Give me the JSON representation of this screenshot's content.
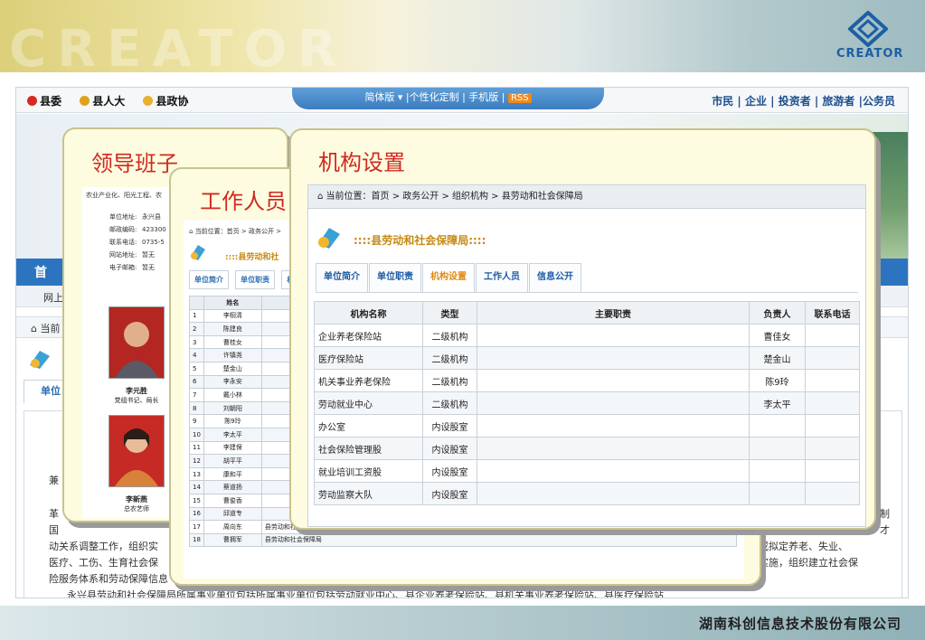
{
  "slide": {
    "watermark": "CREATOR",
    "logo_text": "CREATOR",
    "company": "湖南科创信息技术股份有限公司"
  },
  "bg_page": {
    "top_left_links": [
      "县委",
      "县人大",
      "县政协"
    ],
    "top_band": "简体版 ▾ |个性化定制 | 手机版 |",
    "rss": "RSS",
    "top_right_links": "市民 | 企业 | 投资者 | 旅游者 |公务员",
    "nav_home": "首",
    "subnav_text": "网上",
    "crumb_text": "当前",
    "unit_tab": "单位",
    "body_lines": [
      "兼",
      "革",
      "国",
      "动关系调整工作，组织实",
      "医疗、工伤、生育社会保",
      "险服务体系和劳动保障信息",
      "永兴县劳动和社会保障局所属事业单位包括所属事业单位包括劳动就业中心、县企业养老保险站、县机关事业养老保险站、县医疗保险站",
      "制",
      "才",
      "订或拟定养老、失业、",
      "织实施，组织建立社会保"
    ]
  },
  "leader_panel": {
    "title": "领导班子",
    "header_text": "农业产业化、阳光工程、农",
    "info": [
      {
        "label": "单位地址:",
        "value": "永兴县"
      },
      {
        "label": "邮政编码:",
        "value": "423300"
      },
      {
        "label": "联系电话:",
        "value": "0735-5"
      },
      {
        "label": "网站地址:",
        "value": "暂无"
      },
      {
        "label": "电子邮箱:",
        "value": "暂无"
      }
    ],
    "people": [
      {
        "name": "李元胜",
        "title": "党组书记、局长"
      },
      {
        "name": "李新燕",
        "title": "总农艺师"
      }
    ]
  },
  "staff_panel": {
    "title": "工作人员",
    "crumb": "当前位置：首页 > 政务公开 >",
    "org_name": "::::县劳动和社",
    "tabs": [
      "单位简介",
      "单位职责",
      "机"
    ],
    "header_name": "姓名",
    "rows": [
      {
        "no": "1",
        "name": "李栩清",
        "org": ""
      },
      {
        "no": "2",
        "name": "陈建良",
        "org": ""
      },
      {
        "no": "3",
        "name": "曹桂女",
        "org": ""
      },
      {
        "no": "4",
        "name": "许镇尧",
        "org": ""
      },
      {
        "no": "5",
        "name": "楚金山",
        "org": ""
      },
      {
        "no": "6",
        "name": "李永安",
        "org": ""
      },
      {
        "no": "7",
        "name": "戴小林",
        "org": ""
      },
      {
        "no": "8",
        "name": "刘朝阳",
        "org": ""
      },
      {
        "no": "9",
        "name": "陈9玲",
        "org": ""
      },
      {
        "no": "10",
        "name": "李太平",
        "org": ""
      },
      {
        "no": "11",
        "name": "李建保",
        "org": ""
      },
      {
        "no": "12",
        "name": "胡平平",
        "org": ""
      },
      {
        "no": "13",
        "name": "康和平",
        "org": ""
      },
      {
        "no": "14",
        "name": "蔡道扬",
        "org": ""
      },
      {
        "no": "15",
        "name": "曹俊香",
        "org": ""
      },
      {
        "no": "16",
        "name": "邱道专",
        "org": ""
      },
      {
        "no": "17",
        "name": "周向东",
        "org": "县劳动和社会保障局"
      },
      {
        "no": "18",
        "name": "曹拥军",
        "org": "县劳动和社会保障局"
      }
    ]
  },
  "org_panel": {
    "title": "机构设置",
    "crumb": "当前位置：首页 > 政务公开 > 组织机构 > 县劳动和社会保障局",
    "org_name": "::::县劳动和社会保障局::::",
    "tabs": [
      {
        "label": "单位简介",
        "active": false
      },
      {
        "label": "单位职责",
        "active": false
      },
      {
        "label": "机构设置",
        "active": true
      },
      {
        "label": "工作人员",
        "active": false
      },
      {
        "label": "信息公开",
        "active": false
      }
    ],
    "headers": [
      "机构名称",
      "类型",
      "主要职责",
      "负责人",
      "联系电话"
    ],
    "rows": [
      {
        "name": "企业养老保险站",
        "type": "二级机构",
        "duty": "",
        "head": "曹佳女",
        "phone": ""
      },
      {
        "name": "医疗保险站",
        "type": "二级机构",
        "duty": "",
        "head": "楚金山",
        "phone": ""
      },
      {
        "name": "机关事业养老保险",
        "type": "二级机构",
        "duty": "",
        "head": "陈9玲",
        "phone": ""
      },
      {
        "name": "劳动就业中心",
        "type": "二级机构",
        "duty": "",
        "head": "李太平",
        "phone": ""
      },
      {
        "name": "办公室",
        "type": "内设股室",
        "duty": "",
        "head": "",
        "phone": ""
      },
      {
        "name": "社会保险管理股",
        "type": "内设股室",
        "duty": "",
        "head": "",
        "phone": ""
      },
      {
        "name": "就业培训工资股",
        "type": "内设股室",
        "duty": "",
        "head": "",
        "phone": ""
      },
      {
        "name": "劳动监察大队",
        "type": "内设股室",
        "duty": "",
        "head": "",
        "phone": ""
      }
    ]
  },
  "colors": {
    "title_red": "#d12a1f",
    "panel_fill": "#fdfce0",
    "nav_blue": "#2c74c0",
    "org_gold": "#c78a12",
    "tab_active": "#e08a12"
  }
}
